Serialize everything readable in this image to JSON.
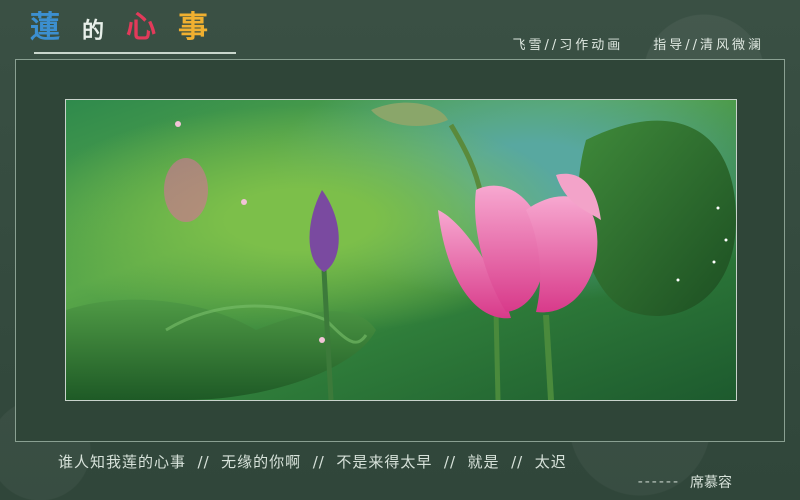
{
  "header": {
    "title_chars": [
      "蓮",
      "的",
      "心",
      "事"
    ],
    "credit_left": "飞雪//习作动画",
    "credit_right": "指导//清风微澜"
  },
  "footer": {
    "poem": "谁人知我莲的心事  //  无缘的你啊  //  不是来得太早  //  就是  //  太迟",
    "signature_dash": "------",
    "signature_name": "席慕容"
  }
}
